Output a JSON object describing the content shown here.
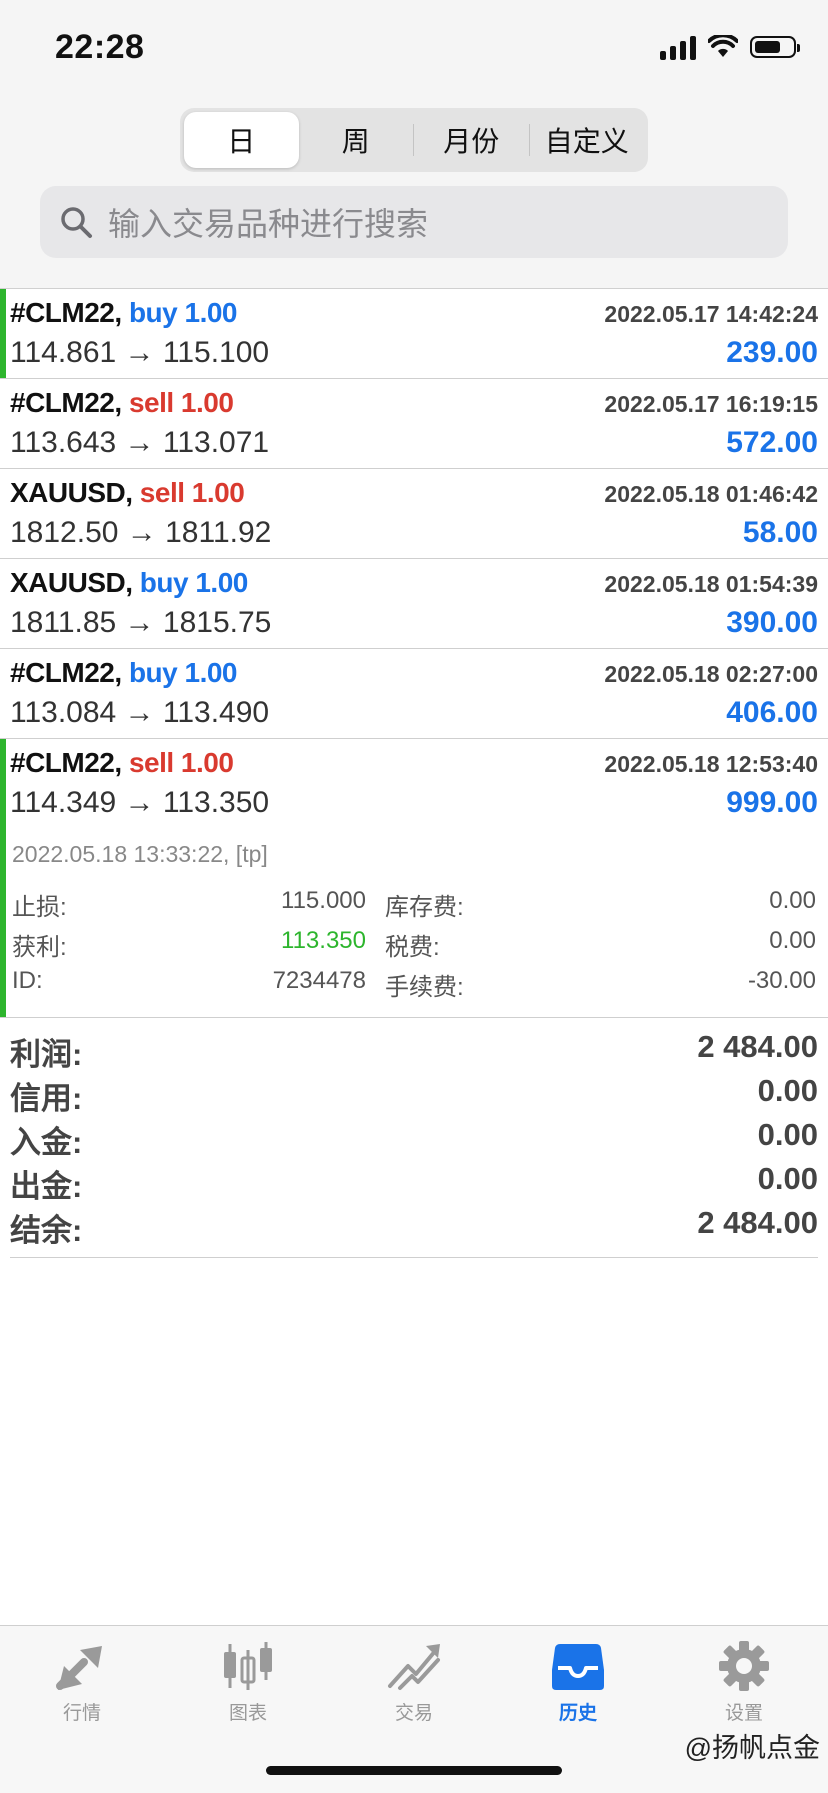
{
  "status_bar": {
    "time": "22:28"
  },
  "period_tabs": [
    {
      "label": "日",
      "active": true
    },
    {
      "label": "周",
      "active": false
    },
    {
      "label": "月份",
      "active": false
    },
    {
      "label": "自定义",
      "active": false
    }
  ],
  "search": {
    "placeholder": "输入交易品种进行搜索"
  },
  "trades": [
    {
      "symbol": "#CLM22,",
      "direction": "buy",
      "volume": "1.00",
      "datetime": "2022.05.17 14:42:24",
      "prices": "114.861 → 115.100",
      "profit": "239.00"
    },
    {
      "symbol": "#CLM22,",
      "direction": "sell",
      "volume": "1.00",
      "datetime": "2022.05.17 16:19:15",
      "prices": "113.643 → 113.071",
      "profit": "572.00"
    },
    {
      "symbol": "XAUUSD,",
      "direction": "sell",
      "volume": "1.00",
      "datetime": "2022.05.18 01:46:42",
      "prices": "1812.50 → 1811.92",
      "profit": "58.00"
    },
    {
      "symbol": "XAUUSD,",
      "direction": "buy",
      "volume": "1.00",
      "datetime": "2022.05.18 01:54:39",
      "prices": "1811.85 → 1815.75",
      "profit": "390.00"
    },
    {
      "symbol": "#CLM22,",
      "direction": "buy",
      "volume": "1.00",
      "datetime": "2022.05.18 02:27:00",
      "prices": "113.084 → 113.490",
      "profit": "406.00"
    }
  ],
  "expanded_trade": {
    "symbol": "#CLM22,",
    "direction": "sell",
    "volume": "1.00",
    "datetime": "2022.05.18 12:53:40",
    "prices": "114.349 → 113.350",
    "profit": "999.00",
    "close_info": "2022.05.18 13:33:22, [tp]",
    "details": {
      "stop_loss_label": "止损:",
      "stop_loss": "115.000",
      "take_profit_label": "获利:",
      "take_profit": "113.350",
      "id_label": "ID:",
      "id": "7234478",
      "swap_label": "库存费:",
      "swap": "0.00",
      "tax_label": "税费:",
      "tax": "0.00",
      "commission_label": "手续费:",
      "commission": "-30.00"
    }
  },
  "summary": [
    {
      "label": "利润:",
      "value": "2 484.00"
    },
    {
      "label": "信用:",
      "value": "0.00"
    },
    {
      "label": "入金:",
      "value": "0.00"
    },
    {
      "label": "出金:",
      "value": "0.00"
    },
    {
      "label": "结余:",
      "value": "2 484.00"
    }
  ],
  "tabbar": [
    {
      "label": "行情",
      "icon": "quotes-arrows-icon",
      "active": false
    },
    {
      "label": "图表",
      "icon": "candlestick-chart-icon",
      "active": false
    },
    {
      "label": "交易",
      "icon": "trade-trend-icon",
      "active": false
    },
    {
      "label": "历史",
      "icon": "history-inbox-icon",
      "active": true
    },
    {
      "label": "设置",
      "icon": "gear-icon",
      "active": false
    }
  ],
  "watermark": "@扬帆点金",
  "colors": {
    "buy": "#1a73e8",
    "sell": "#d93a2f",
    "profit": "#1a73e8",
    "accent_green": "#2db52d"
  }
}
